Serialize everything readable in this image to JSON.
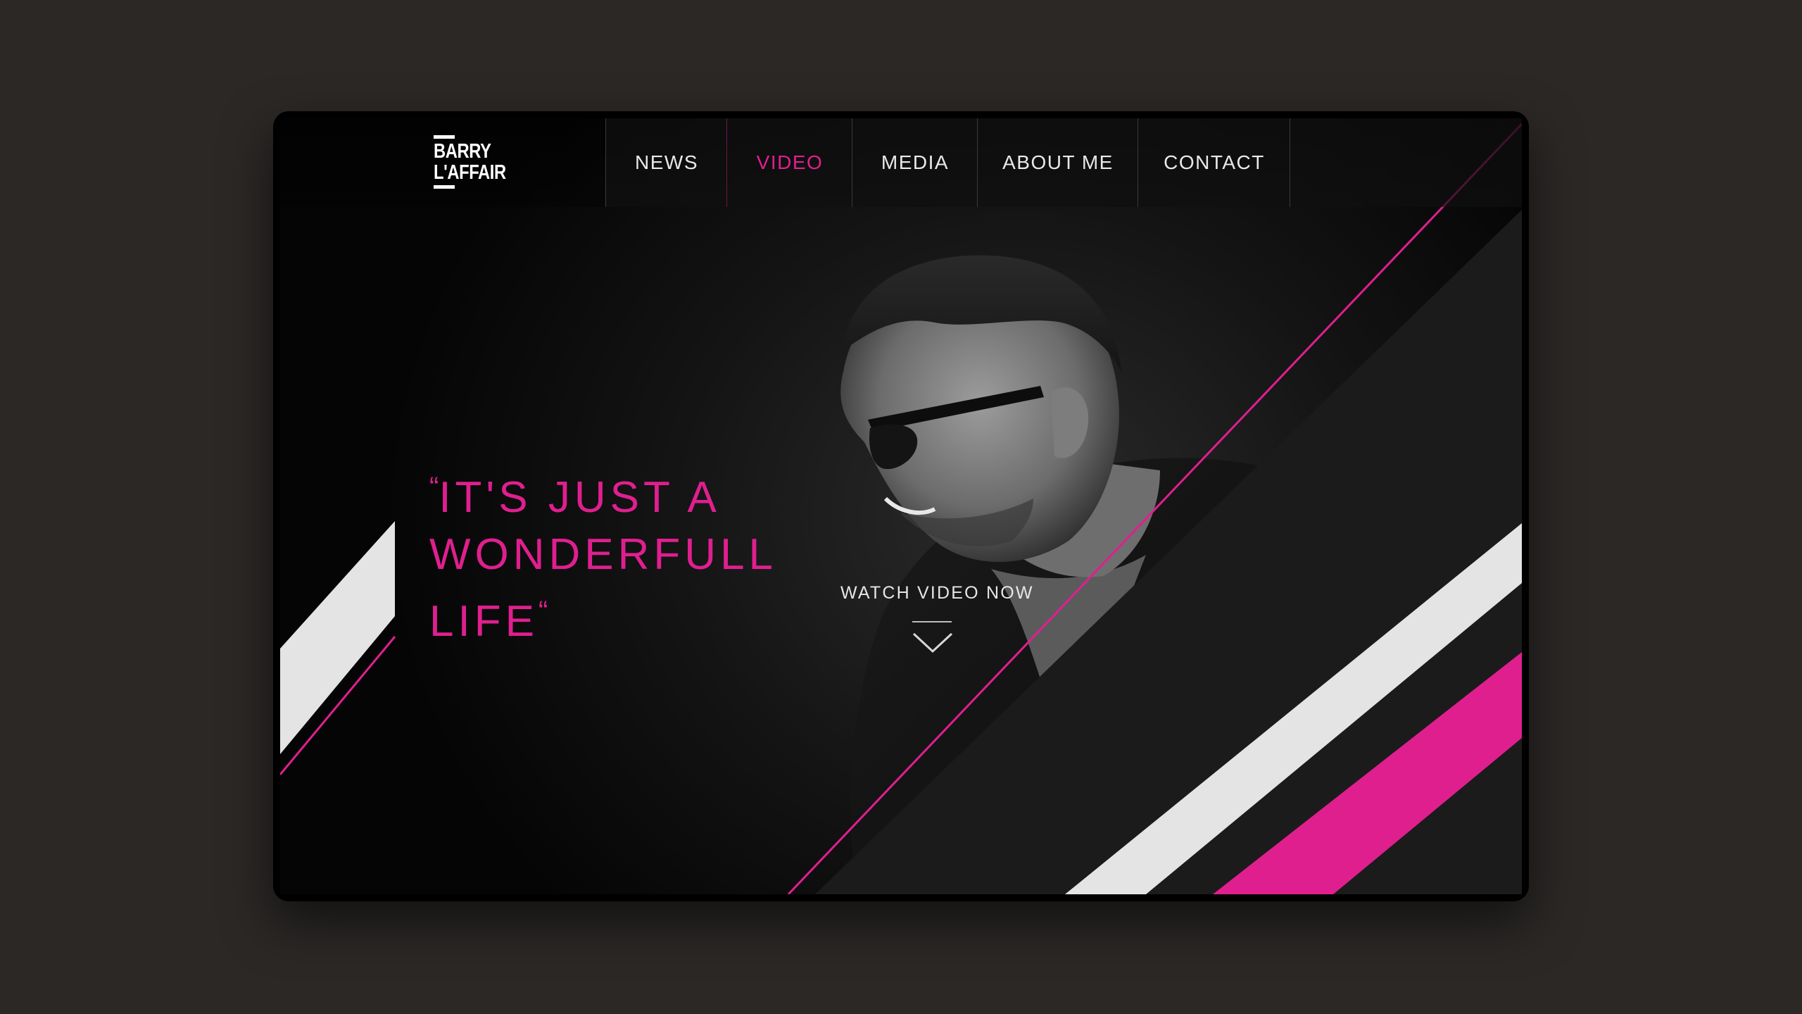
{
  "brand": {
    "line1": "BARRY",
    "line2": "L'AFFAIR"
  },
  "nav": {
    "items": [
      {
        "label": "NEWS",
        "active": false
      },
      {
        "label": "VIDEO",
        "active": true
      },
      {
        "label": "MEDIA",
        "active": false
      },
      {
        "label": "ABOUT ME",
        "active": false
      },
      {
        "label": "CONTACT",
        "active": false
      }
    ]
  },
  "hero": {
    "open_quote": "“",
    "line1": "IT'S JUST A",
    "line2": "WONDERFULL",
    "line3": "LIFE",
    "close_quote": "“",
    "cta": "WATCH VIDEO NOW"
  },
  "icons": {
    "cta": "chevron-down-icon"
  },
  "colors": {
    "accent": "#e01f8f",
    "stripe_light": "#e4e4e4",
    "background": "#2b2826",
    "panel": "#000000"
  }
}
